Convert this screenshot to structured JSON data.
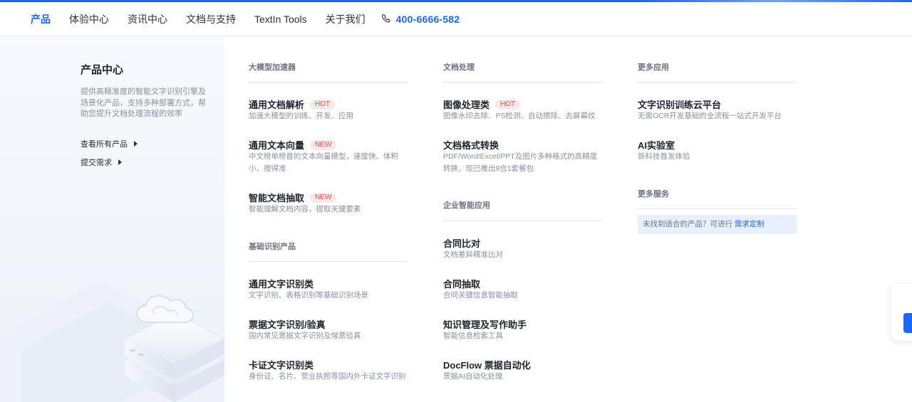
{
  "nav": {
    "items": [
      "产品",
      "体验中心",
      "资讯中心",
      "文档与支持",
      "TextIn Tools",
      "关于我们"
    ],
    "phone": "400-6666-582"
  },
  "left": {
    "title": "产品中心",
    "desc": "提供高精准度的智能文字识别引擎及场景化产品，支持多种部署方式，帮助您提升文档处理流程的效率",
    "links": [
      "查看所有产品",
      "提交需求"
    ]
  },
  "col1": {
    "sec1": "大模型加速器",
    "items1": [
      {
        "title": "通用文档解析",
        "badge": "HOT",
        "desc": "加速大模型的训练、开发、应用"
      },
      {
        "title": "通用文本向量",
        "badge": "NEW",
        "desc": "中文榜单榜首的文本向量模型，速度快、体积小、搜得准"
      },
      {
        "title": "智能文档抽取",
        "badge": "NEW",
        "desc": "智能理解文档内容，提取关键要素"
      }
    ],
    "sec2": "基础识别产品",
    "items2": [
      {
        "title": "通用文字识别类",
        "desc": "文字识别、表格识别等基础识别场景"
      },
      {
        "title": "票据文字识别/验真",
        "desc": "国内常见票据文字识别及增票验真"
      },
      {
        "title": "卡证文字识别类",
        "desc": "身份证、名片、营业执照等国内外卡证文字识别"
      }
    ]
  },
  "col2": {
    "sec1": "文档处理",
    "items1": [
      {
        "title": "图像处理类",
        "badge": "HOT",
        "desc": "图像水印去除、PS检测、自动擦除、去屏幕纹"
      },
      {
        "title": "文档格式转换",
        "desc": "PDF/Word/Excel/PPT及图片多种格式的高精度转换，现已推出9合1套餐包"
      }
    ],
    "sec2": "企业智能应用",
    "items2": [
      {
        "title": "合同比对",
        "desc": "文档差异精准比对"
      },
      {
        "title": "合同抽取",
        "desc": "合同关键信息智能抽取"
      },
      {
        "title": "知识管理及写作助手",
        "desc": "智能信息检索工具"
      },
      {
        "title": "DocFlow 票据自动化",
        "desc": "票据AI自动化处理"
      }
    ]
  },
  "col3": {
    "sec1": "更多应用",
    "items1": [
      {
        "title": "文字识别训练云平台",
        "desc": "无需OCR开发基础的全流程一站式开发平台"
      },
      {
        "title": "AI实验室",
        "desc": "新科技首发体验"
      }
    ],
    "sec2": "更多服务",
    "service_text": "未找到适合的产品？可进行",
    "service_link": "需求定制"
  },
  "colors": {
    "accent": "#1a66ff",
    "hot": "#e5484d",
    "panel": "#f3f6fa"
  }
}
